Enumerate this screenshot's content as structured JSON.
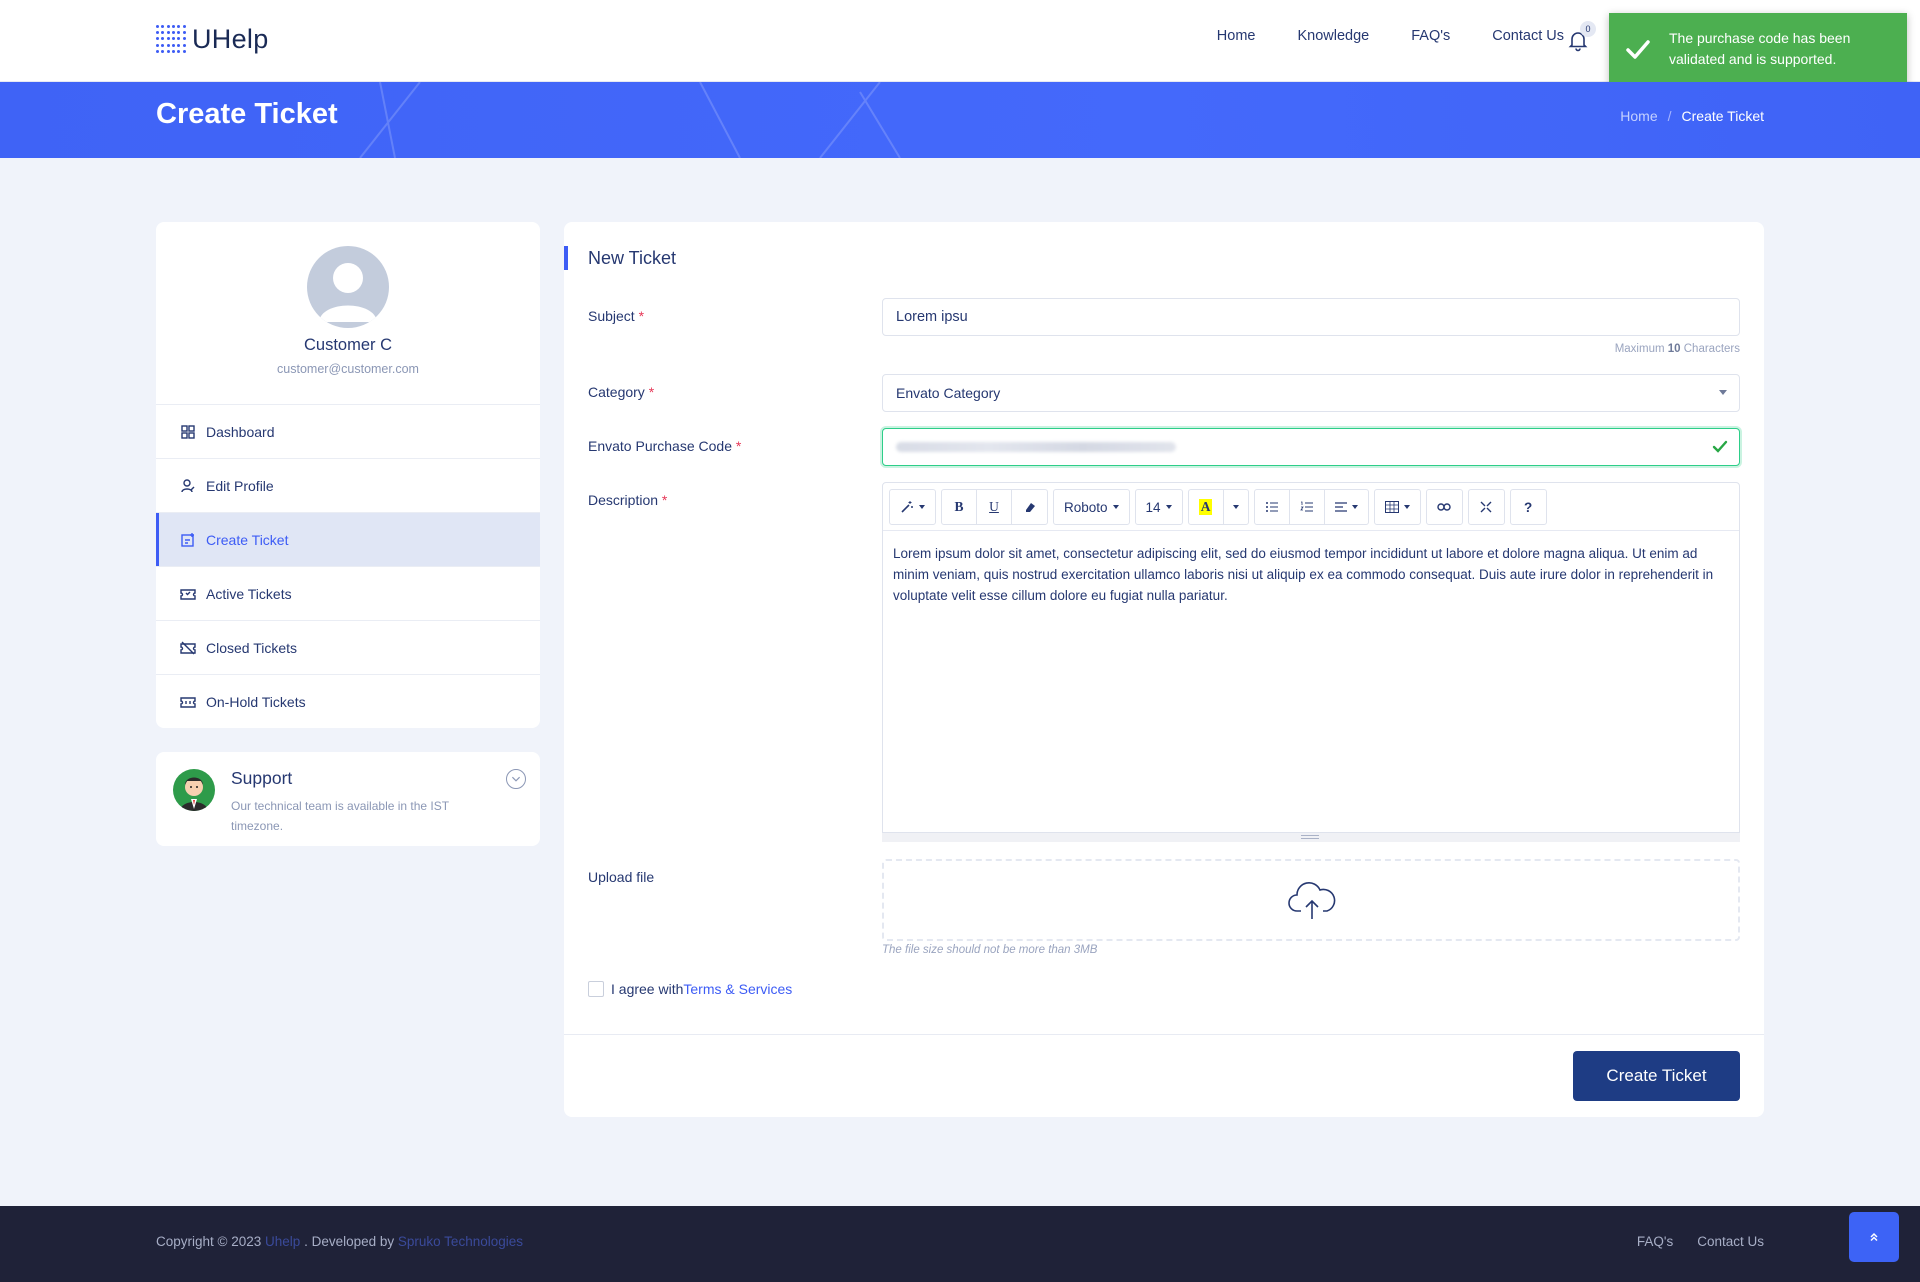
{
  "brand": {
    "name": "UHelp"
  },
  "nav": {
    "items": [
      "Home",
      "Knowledge",
      "FAQ's",
      "Contact Us"
    ],
    "notification_count": "0"
  },
  "toast": {
    "message": "The purchase code has been validated and is supported.",
    "color": "#4caf50"
  },
  "banner": {
    "title": "Create Ticket",
    "breadcrumb": {
      "home": "Home",
      "separator": "/",
      "current": "Create Ticket"
    },
    "color": "#4469fb"
  },
  "sidebar": {
    "name": "Customer C",
    "email": "customer@customer.com",
    "items": [
      {
        "label": "Dashboard",
        "icon": "dashboard-icon"
      },
      {
        "label": "Edit Profile",
        "icon": "user-edit-icon"
      },
      {
        "label": "Create Ticket",
        "icon": "ticket-add-icon",
        "active": true
      },
      {
        "label": "Active Tickets",
        "icon": "ticket-icon"
      },
      {
        "label": "Closed Tickets",
        "icon": "ticket-closed-icon"
      },
      {
        "label": "On-Hold Tickets",
        "icon": "ticket-hold-icon"
      }
    ]
  },
  "support": {
    "title": "Support",
    "description": "Our technical team is available in the IST timezone."
  },
  "form": {
    "heading": "New Ticket",
    "subject": {
      "label": "Subject",
      "value": "Lorem ipsu",
      "hint_prefix": "Maximum",
      "hint_count": "10",
      "hint_suffix": "Characters"
    },
    "category": {
      "label": "Category",
      "value": "Envato Category"
    },
    "purchase_code": {
      "label": "Envato Purchase Code",
      "status": "valid"
    },
    "description": {
      "label": "Description",
      "toolbar": {
        "font": "Roboto",
        "size": "14",
        "bold": "B",
        "underline": "U",
        "help": "?"
      },
      "text": "Lorem ipsum dolor sit amet, consectetur adipiscing elit, sed do eiusmod tempor incididunt ut labore et dolore magna aliqua. Ut enim ad minim veniam, quis nostrud exercitation ullamco laboris nisi ut aliquip ex ea commodo consequat. Duis aute irure dolor in reprehenderit in voluptate velit esse cillum dolore eu fugiat nulla pariatur."
    },
    "upload": {
      "label": "Upload file",
      "note": "The file size should not be more than 3MB"
    },
    "agree": {
      "text": "I agree with",
      "link": "Terms & Services"
    },
    "submit": "Create Ticket"
  },
  "footer": {
    "copyright": "Copyright © 2023",
    "brand_link": "Uhelp",
    "developed_by": ". Developed by",
    "dev_link": "Spruko Technologies",
    "links": [
      "FAQ's",
      "Contact Us"
    ]
  }
}
